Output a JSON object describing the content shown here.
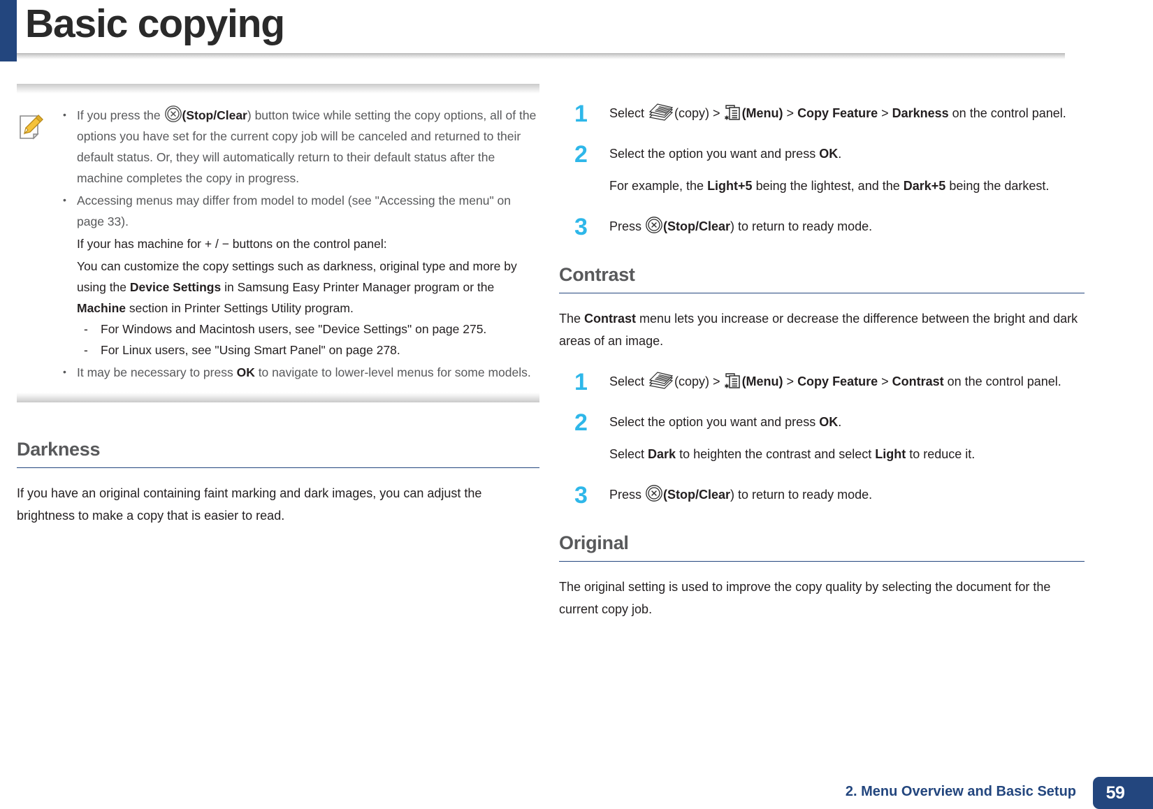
{
  "header": {
    "title": "Basic copying",
    "accent_color": "#23467e"
  },
  "note": {
    "icon": "note-pencil-icon",
    "bullets": [
      {
        "id": "stop-clear-note",
        "pre": "If you press the ",
        "icon": "stop-clear-icon",
        "post_bold": "(Stop/Clear",
        "post": ") button twice while setting the copy options, all of the options you have set for the current copy job will be canceled and returned to their default status. Or, they will automatically return to their default status after the machine completes the copy in progress."
      },
      {
        "id": "accessing-menus-note",
        "text": "Accessing menus may differ from model to model (see \"Accessing the menu\" on page 33)."
      },
      {
        "id": "ok-navigate-note",
        "pre": "It may be necessary to press ",
        "bold": "OK",
        "post": " to navigate to lower-level menus for some models."
      }
    ],
    "plus_minus_intro": "If your has machine for + / −  buttons on the control panel:",
    "customize_text_1": "You can customize the copy settings such as darkness, original type and more by using the ",
    "customize_bold_1": "Device Settings",
    "customize_text_2": " in Samsung Easy Printer Manager program or the ",
    "customize_bold_2": "Machine",
    "customize_text_3": " section in Printer Settings Utility program.",
    "dashes": [
      "For Windows and Macintosh users, see \"Device Settings\" on page 275.",
      "For Linux users, see \"Using Smart Panel\" on page 278."
    ]
  },
  "darkness": {
    "heading": "Darkness",
    "intro": "If you have an original containing faint marking and dark images, you can adjust the brightness to make a copy that is easier to read.",
    "steps": [
      {
        "num": "1",
        "seg_select": "Select ",
        "icon_copy": "copy-icon",
        "seg_copy": "(copy) > ",
        "icon_menu": "menu-icon",
        "seg_menu_bold": "(Menu)",
        "seg_gt1": " > ",
        "seg_copy_feature": "Copy Feature",
        "seg_gt2": " > ",
        "seg_target": "Darkness",
        "seg_tail": " on the control panel."
      },
      {
        "num": "2",
        "main_pre": "Select the option you want and press ",
        "main_bold": "OK",
        "main_post": ".",
        "sub_pre": "For example, the ",
        "sub_bold1": "Light+5",
        "sub_mid": " being the lightest, and the ",
        "sub_bold2": "Dark+5",
        "sub_post": " being the darkest."
      },
      {
        "num": "3",
        "press_pre": "Press ",
        "icon_stop": "stop-clear-icon",
        "press_bold": "(Stop/Clear",
        "press_post": ") to return to ready mode."
      }
    ]
  },
  "contrast": {
    "heading": "Contrast",
    "intro_pre": "The ",
    "intro_bold": "Contrast",
    "intro_post": " menu lets you increase or decrease the difference between the bright and dark areas of an image.",
    "steps": [
      {
        "num": "1",
        "seg_select": "Select ",
        "seg_copy": "(copy) > ",
        "seg_menu_bold": "(Menu)",
        "seg_gt1": " > ",
        "seg_copy_feature": "Copy Feature",
        "seg_gt2": " > ",
        "seg_target": "Contrast",
        "seg_tail": " on the control panel."
      },
      {
        "num": "2",
        "main_pre": "Select the option you want and press ",
        "main_bold": "OK",
        "main_post": ".",
        "sub_pre": "Select ",
        "sub_bold1": "Dark",
        "sub_mid": " to heighten the contrast and select ",
        "sub_bold2": "Light",
        "sub_post": " to reduce it."
      },
      {
        "num": "3",
        "press_pre": "Press ",
        "press_bold": "(Stop/Clear",
        "press_post": ") to return to ready mode."
      }
    ]
  },
  "original": {
    "heading": "Original",
    "intro": "The original setting is used to improve the copy quality by selecting the document for the current copy job."
  },
  "footer": {
    "label": "2.  Menu Overview and Basic Setup",
    "page": "59",
    "color": "#23467e"
  }
}
